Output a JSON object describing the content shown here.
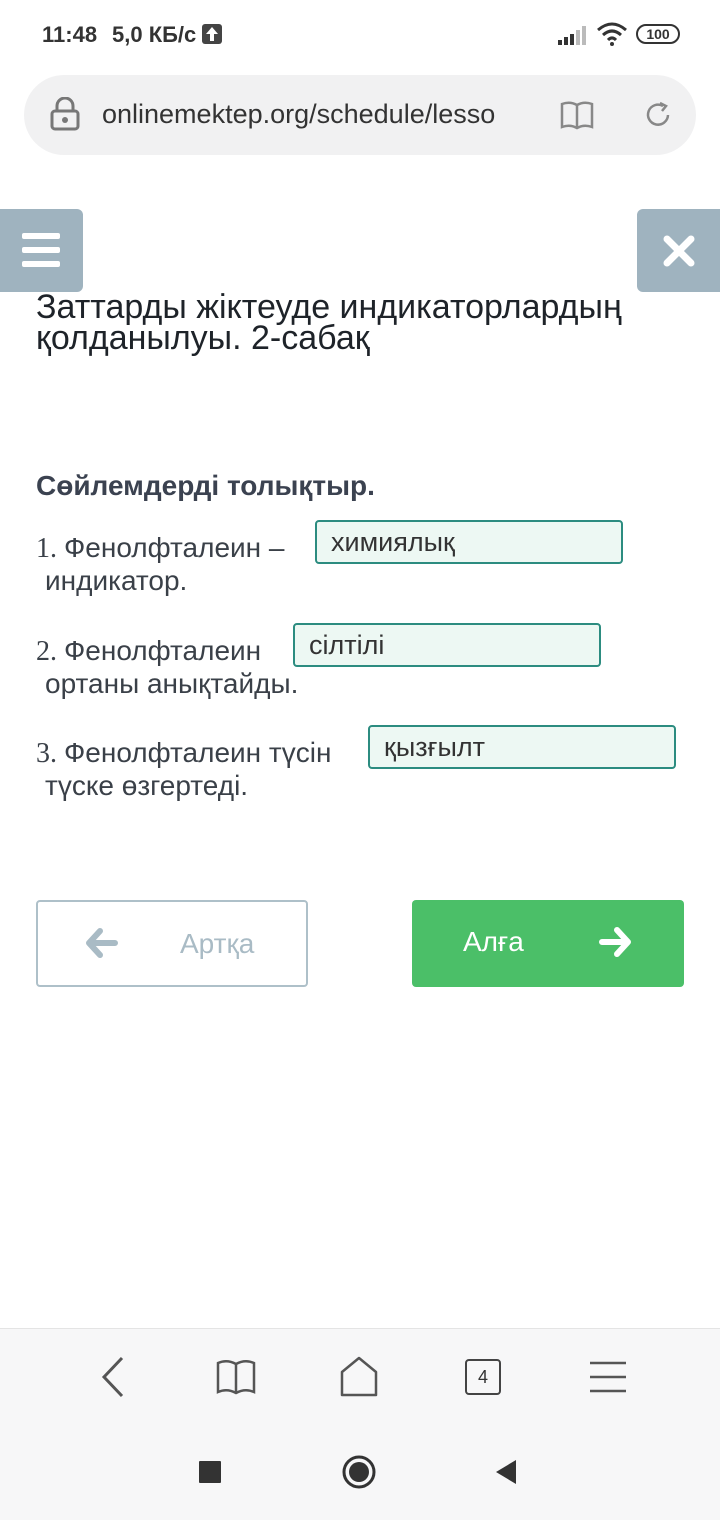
{
  "status_bar": {
    "time": "11:48",
    "speed": "5,0 КБ/с",
    "battery": "100",
    "icons": [
      "upload-icon",
      "signal-icon",
      "wifi-icon",
      "battery-icon"
    ]
  },
  "browser": {
    "url": "onlinemektep.org/schedule/lesso",
    "icons": [
      "lock-icon",
      "reader-icon",
      "reload-icon"
    ],
    "bottom_bar": {
      "tab_count": "4",
      "icons": [
        "back-icon",
        "bookmarks-icon",
        "home-icon",
        "tabs-icon",
        "menu-icon"
      ]
    }
  },
  "lesson": {
    "title": "Заттарды жіктеуде индикаторлардың қолданылуы. 2-сабақ",
    "instruction": "Сөйлемдерді толықтыр.",
    "sentences": [
      {
        "number": "1.",
        "before": "Фенолфталеин –",
        "answer": "химиялық",
        "after": "индикатор."
      },
      {
        "number": "2.",
        "before": "Фенолфталеин",
        "answer": "сілтілі",
        "after": "ортаны анықтайды."
      },
      {
        "number": "3.",
        "before": "Фенолфталеин түсін",
        "answer": "қызғылт",
        "after": "түске өзгертеді."
      }
    ]
  },
  "navigation": {
    "back_label": "Артқа",
    "next_label": "Алға"
  },
  "colors": {
    "menu_button": "#9fb3bf",
    "answer_border": "#2c8c80",
    "answer_bg": "#edf8f3",
    "next_button": "#4bbf68",
    "back_border": "#aec0c9"
  }
}
